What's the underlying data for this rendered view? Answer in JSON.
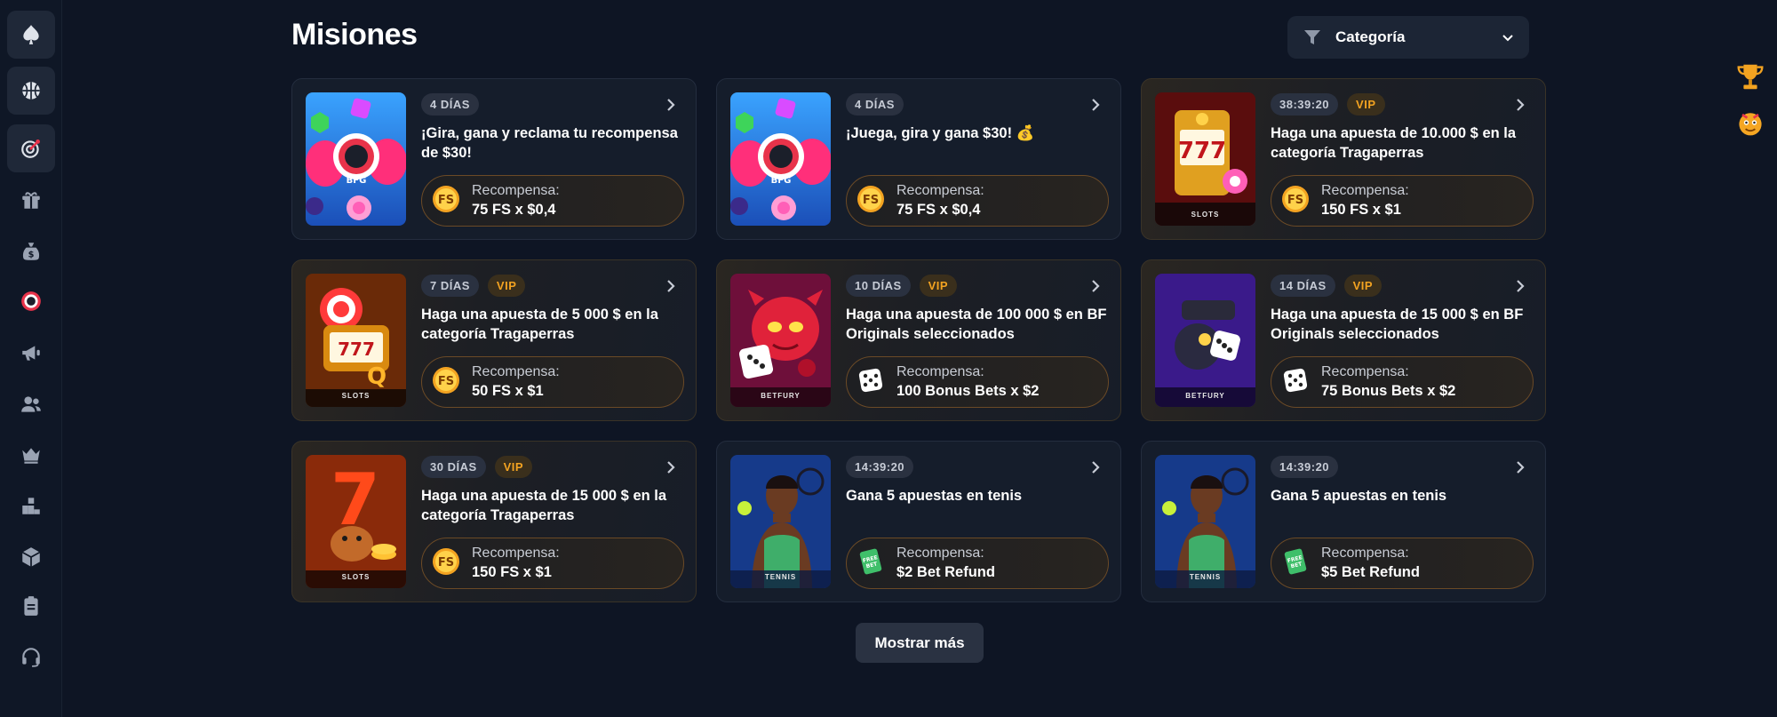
{
  "page": {
    "title": "Misiones"
  },
  "category": {
    "label": "Categoría"
  },
  "sidebar": {
    "items": [
      {
        "name": "spade-icon"
      },
      {
        "name": "basketball-icon"
      },
      {
        "name": "target-icon"
      },
      {
        "name": "gift-icon"
      },
      {
        "name": "money-bag-icon"
      },
      {
        "name": "bfg-logo-icon"
      },
      {
        "name": "megaphone-icon"
      },
      {
        "name": "users-icon"
      },
      {
        "name": "crown-icon"
      },
      {
        "name": "leaderboard-icon"
      },
      {
        "name": "box-icon"
      },
      {
        "name": "clipboard-icon"
      },
      {
        "name": "headset-icon"
      }
    ]
  },
  "right_rail": {
    "items": [
      {
        "name": "trophy-icon"
      },
      {
        "name": "mascot-avatar-icon"
      }
    ]
  },
  "missions": [
    {
      "time": "4 DÍAS",
      "vip": "",
      "title": "¡Gira, gana y reclama tu recompensa de $30!",
      "reward_label": "Recompensa:",
      "reward_value": "75 FS x $0,4",
      "reward_icon": "fs-coin-icon",
      "thumb": "candy",
      "thumb_tag": ""
    },
    {
      "time": "4 DÍAS",
      "vip": "",
      "title": "¡Juega, gira y gana $30! 💰",
      "reward_label": "Recompensa:",
      "reward_value": "75 FS x $0,4",
      "reward_icon": "fs-coin-icon",
      "thumb": "candy",
      "thumb_tag": ""
    },
    {
      "time": "38:39:20",
      "vip": "VIP",
      "title": "Haga una apuesta de 10.000 $ en la categoría Tragaperras",
      "reward_label": "Recompensa:",
      "reward_value": "150 FS x $1",
      "reward_icon": "fs-coin-icon",
      "thumb": "slot-red",
      "thumb_tag": "SLOTS"
    },
    {
      "time": "7 DÍAS",
      "vip": "VIP",
      "title": "Haga una apuesta de 5 000 $ en la categoría Tragaperras",
      "reward_label": "Recompensa:",
      "reward_value": "50 FS x $1",
      "reward_icon": "fs-coin-icon",
      "thumb": "slot-orange",
      "thumb_tag": "SLOTS"
    },
    {
      "time": "10 DÍAS",
      "vip": "VIP",
      "title": "Haga una apuesta de 100 000 $ en BF Originals seleccionados",
      "reward_label": "Recompensa:",
      "reward_value": "100 Bonus Bets x $2",
      "reward_icon": "dice-icon",
      "thumb": "devil",
      "thumb_tag": "BETFURY"
    },
    {
      "time": "14 DÍAS",
      "vip": "VIP",
      "title": "Haga una apuesta de 15 000 $ en BF Originals seleccionados",
      "reward_label": "Recompensa:",
      "reward_value": "75 Bonus Bets x $2",
      "reward_icon": "dice-icon",
      "thumb": "bomb",
      "thumb_tag": "BETFURY"
    },
    {
      "time": "30 DÍAS",
      "vip": "VIP",
      "title": "Haga una apuesta de 15 000 $ en la categoría Tragaperras",
      "reward_label": "Recompensa:",
      "reward_value": "150 FS x $1",
      "reward_icon": "fs-coin-icon",
      "thumb": "slot-seven",
      "thumb_tag": "SLOTS"
    },
    {
      "time": "14:39:20",
      "vip": "",
      "title": "Gana 5 apuestas en tenis",
      "reward_label": "Recompensa:",
      "reward_value": "$2 Bet Refund",
      "reward_icon": "free-bet-ticket-icon",
      "thumb": "tennis",
      "thumb_tag": "TENNIS"
    },
    {
      "time": "14:39:20",
      "vip": "",
      "title": "Gana 5 apuestas en tenis",
      "reward_label": "Recompensa:",
      "reward_value": "$5 Bet Refund",
      "reward_icon": "free-bet-ticket-icon",
      "thumb": "tennis",
      "thumb_tag": "TENNIS"
    }
  ],
  "show_more": {
    "label": "Mostrar más"
  }
}
